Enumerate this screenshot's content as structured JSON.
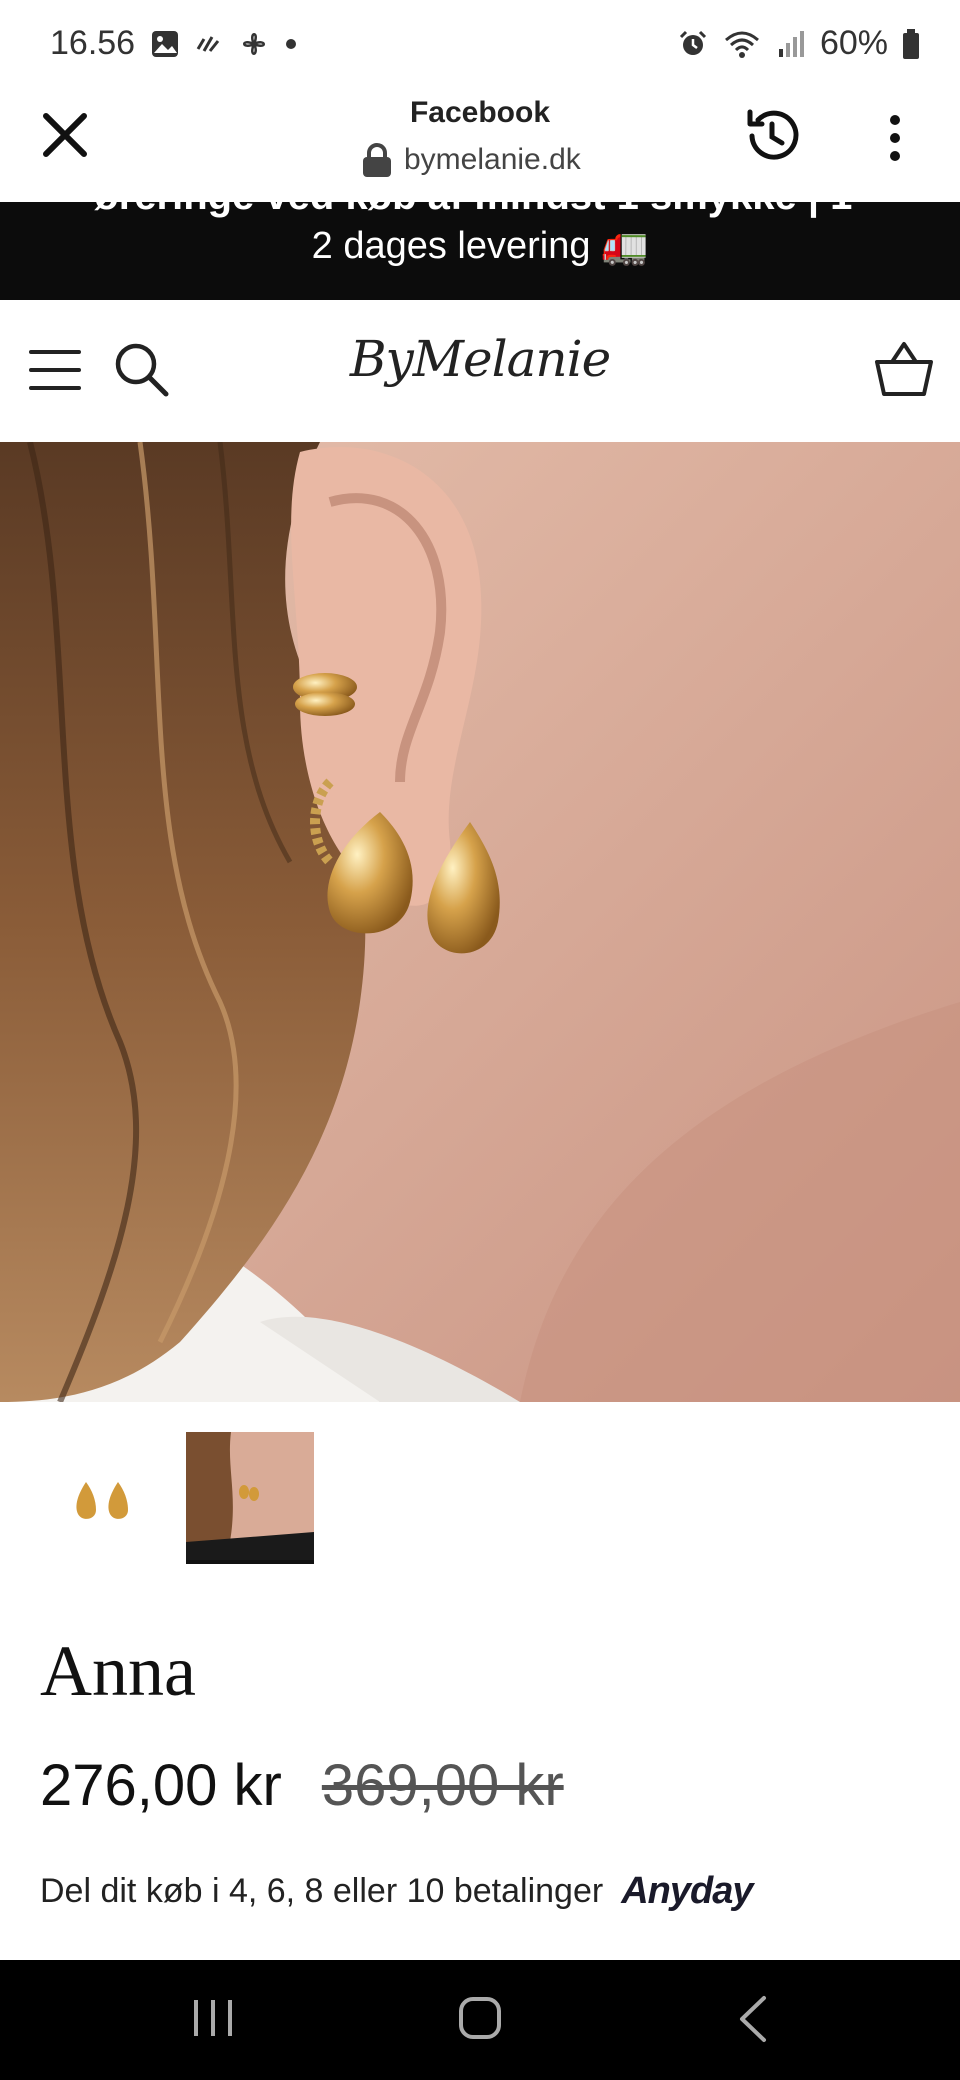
{
  "status_bar": {
    "time": "16.56",
    "battery": "60%"
  },
  "browser": {
    "title": "Facebook",
    "url": "bymelanie.dk"
  },
  "banner": {
    "line1": "øreringe ved køb af mindst 1 smykke | 1-",
    "line2": "2 dages levering 🚛"
  },
  "header": {
    "logo": "ByMelanie"
  },
  "product": {
    "name": "Anna",
    "price_current": "276,00 kr",
    "price_original": "369,00 kr",
    "installment_text": "Del dit køb i 4, 6, 8 eller 10 betalinger",
    "installment_provider": "Anyday"
  },
  "colors": {
    "banner_bg": "#0c0c0c",
    "nav_bg": "#000000",
    "gold": "#c9933a"
  },
  "icons": {
    "close": "close-icon",
    "lock": "lock-icon",
    "history": "history-icon",
    "more": "more-vert-icon",
    "menu": "hamburger-icon",
    "search": "search-icon",
    "cart": "basket-icon"
  }
}
